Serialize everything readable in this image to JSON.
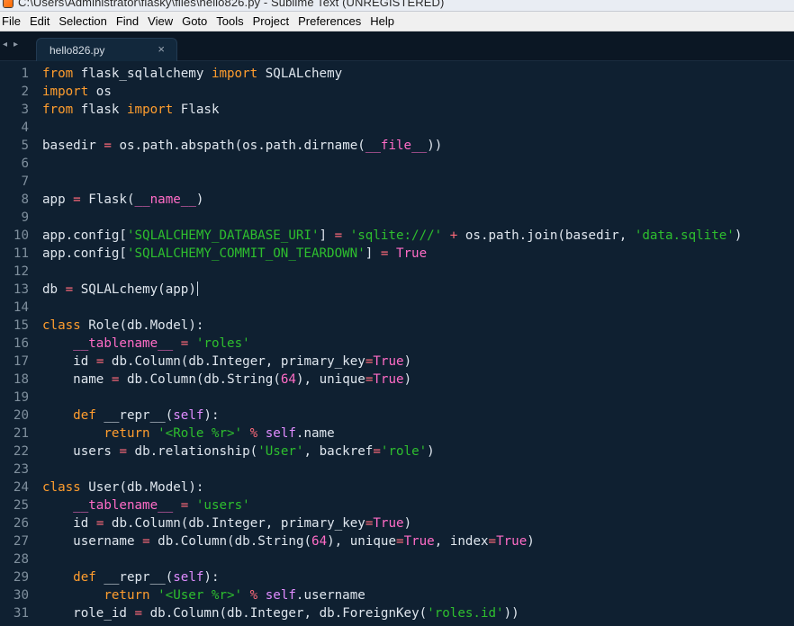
{
  "window": {
    "title": "C:\\Users\\Administrator\\flasky\\files\\hello826.py - Sublime Text (UNREGISTERED)"
  },
  "menu": [
    {
      "key": "file",
      "label": "File"
    },
    {
      "key": "edit",
      "label": "Edit"
    },
    {
      "key": "selection",
      "label": "Selection"
    },
    {
      "key": "find",
      "label": "Find"
    },
    {
      "key": "view",
      "label": "View"
    },
    {
      "key": "goto",
      "label": "Goto"
    },
    {
      "key": "tools",
      "label": "Tools"
    },
    {
      "key": "project",
      "label": "Project"
    },
    {
      "key": "preferences",
      "label": "Preferences"
    },
    {
      "key": "help",
      "label": "Help"
    }
  ],
  "tabs": {
    "nav_left_icon": "◂",
    "nav_right_icon": "▸",
    "active": {
      "label": "hello826.py",
      "close_icon": "×"
    }
  },
  "editor": {
    "line_numbers": [
      "1",
      "2",
      "3",
      "4",
      "5",
      "6",
      "7",
      "8",
      "9",
      "10",
      "11",
      "12",
      "13",
      "14",
      "15",
      "16",
      "17",
      "18",
      "19",
      "20",
      "21",
      "22",
      "23",
      "24",
      "25",
      "26",
      "27",
      "28",
      "29",
      "30",
      "31"
    ],
    "code_lines": [
      "from flask_sqlalchemy import SQLALchemy",
      "import os",
      "from flask import Flask",
      "",
      "basedir = os.path.abspath(os.path.dirname(__file__))",
      "",
      "",
      "app = Flask(__name__)",
      "",
      "app.config['SQLALCHEMY_DATABASE_URI'] = 'sqlite:///' + os.path.join(basedir, 'data.sqlite')",
      "app.config['SQLALCHEMY_COMMIT_ON_TEARDOWN'] = True",
      "",
      "db = SQLALchemy(app)",
      "",
      "class Role(db.Model):",
      "    __tablename__ = 'roles'",
      "    id = db.Column(db.Integer, primary_key=True)",
      "    name = db.Column(db.String(64), unique=True)",
      "",
      "    def __repr__(self):",
      "        return '<Role %r>' % self.name",
      "    users = db.relationship('User', backref='role')",
      "",
      "class User(db.Model):",
      "    __tablename__ = 'users'",
      "    id = db.Column(db.Integer, primary_key=True)",
      "    username = db.Column(db.String(64), unique=True, index=True)",
      "",
      "    def __repr__(self):",
      "        return '<User %r>' % self.username",
      "    role_id = db.Column(db.Integer, db.ForeignKey('roles.id'))"
    ],
    "active_line": 13
  },
  "colors": {
    "background": "#0f2031",
    "tab_bar": "#0b1724",
    "tab_active": "#12283c",
    "gutter_text": "#7f8f9d",
    "keyword": "#ff9d2e",
    "string": "#2ebf2e",
    "constant": "#ff6cc6",
    "operator": "#ff6a7a",
    "plain": "#dfe6ee"
  }
}
